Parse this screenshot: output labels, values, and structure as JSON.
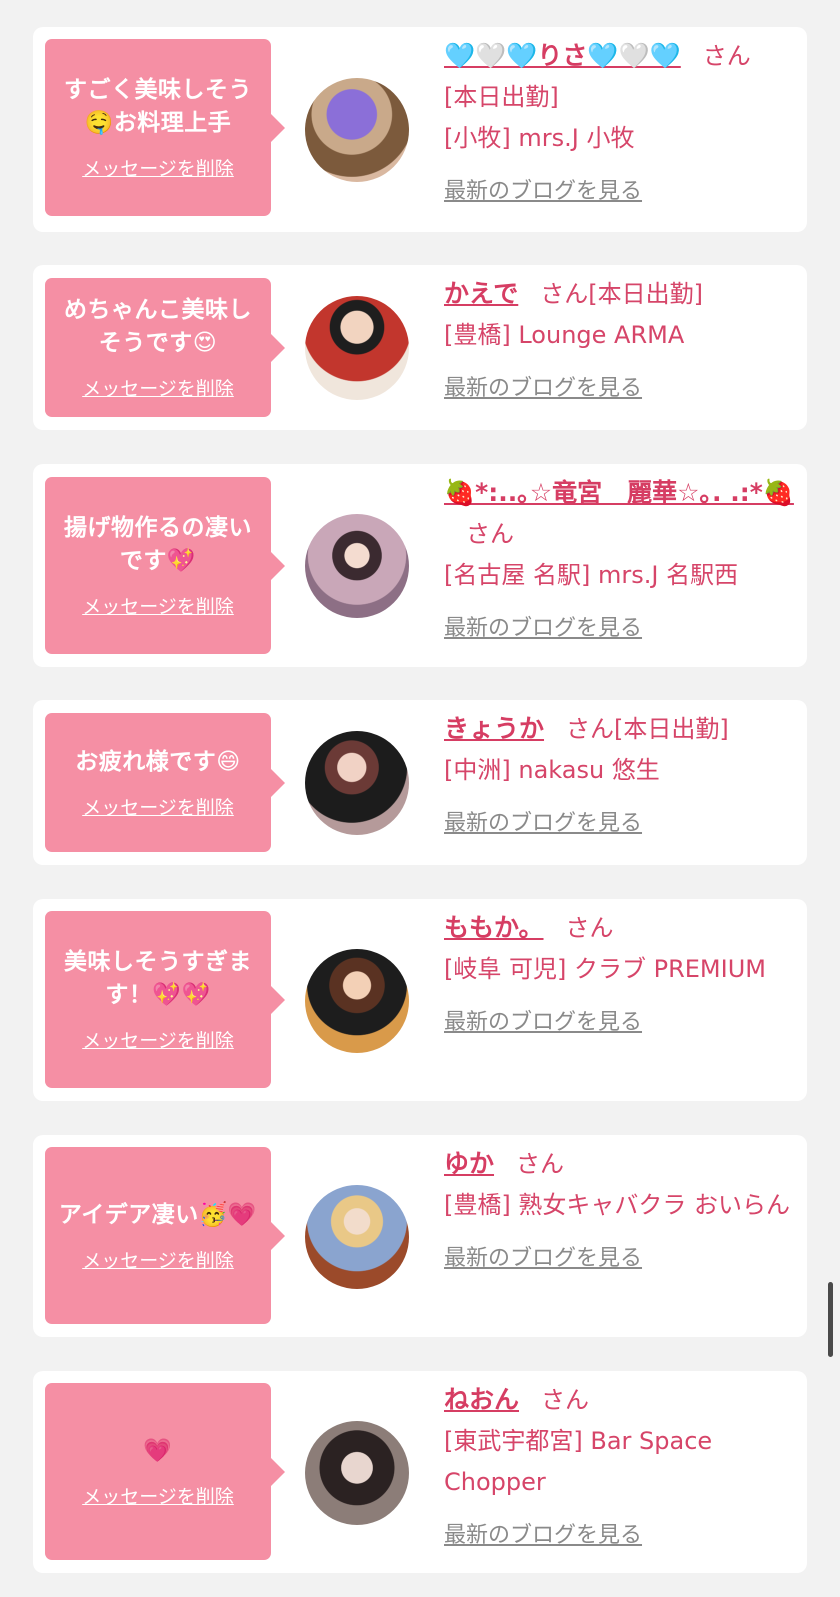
{
  "cards": [
    {
      "message": "すごく美味しそう🤤お料理上手",
      "delete_label": "メッセージを削除",
      "name": "🩵🤍🩵りさ🩵🤍🩵",
      "san": "さん",
      "lines": [
        "[本日出勤]",
        "[小牧] mrs.J 小牧"
      ],
      "blog_label": "最新のブログを見る"
    },
    {
      "message": "めちゃんこ美味しそうです😍",
      "delete_label": "メッセージを削除",
      "name": "かえで",
      "san": "さん[本日出勤]",
      "lines": [
        "[豊橋] Lounge ARMA"
      ],
      "blog_label": "最新のブログを見る"
    },
    {
      "message": "揚げ物作るの凄いです💖",
      "delete_label": "メッセージを削除",
      "name": "🍓*:..｡☆竜宮　麗華☆｡. .:*🍓",
      "san": "さん",
      "lines": [
        "[名古屋 名駅] mrs.J 名駅西"
      ],
      "blog_label": "最新のブログを見る"
    },
    {
      "message": "お疲れ様です😄",
      "delete_label": "メッセージを削除",
      "name": "きょうか",
      "san": "さん[本日出勤]",
      "lines": [
        "[中洲] nakasu 悠生"
      ],
      "blog_label": "最新のブログを見る"
    },
    {
      "message": "美味しそうすぎます！💖💖",
      "delete_label": "メッセージを削除",
      "name": "ももか。",
      "san": "さん",
      "lines": [
        "[岐阜 可児] クラブ PREMIUM"
      ],
      "blog_label": "最新のブログを見る"
    },
    {
      "message": "アイデア凄い🥳💗",
      "delete_label": "メッセージを削除",
      "name": "ゆか",
      "san": "さん",
      "lines": [
        "[豊橋] 熟女キャバクラ おいらん"
      ],
      "blog_label": "最新のブログを見る"
    },
    {
      "message": "💗",
      "delete_label": "メッセージを削除",
      "name": "ねおん",
      "san": "さん",
      "lines": [
        "[東武宇都宮] Bar Space Chopper"
      ],
      "blog_label": "最新のブログを見る"
    }
  ],
  "colors": {
    "page_bg": "#f2f2f2",
    "card_bg": "#ffffff",
    "bubble_pink": "#f58fa4",
    "name_pink": "#d63d63",
    "info_pink": "#d64569",
    "link_gray": "#8a8a8a"
  }
}
